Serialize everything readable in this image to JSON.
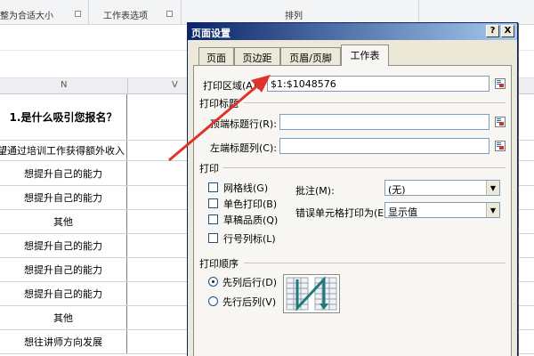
{
  "ribbon": {
    "group_fit": "整为合适大小",
    "group_sheet_options": "工作表选项",
    "group_arrange": "排列"
  },
  "sheet": {
    "col_n": "N",
    "col_v": "V",
    "rows": [
      "1.是什么吸引您报名？",
      "希望通过培训工作获得额外收入",
      "想提升自己的能力",
      "想提升自己的能力",
      "其他",
      "想提升自己的能力",
      "想提升自己的能力",
      "想提升自己的能力",
      "其他",
      "想往讲师方向发展",
      ""
    ]
  },
  "dialog": {
    "title": "页面设置",
    "help_btn": "?",
    "close_btn": "X",
    "tabs": [
      "页面",
      "页边距",
      "页眉/页脚",
      "工作表"
    ],
    "active_tab": 3,
    "print_area_label": "打印区域(A):",
    "print_area_value": "$1:$1048576",
    "print_titles_label": "打印标题",
    "top_rows_label": "顶端标题行(R):",
    "left_cols_label": "左端标题列(C):",
    "print_label": "打印",
    "gridlines_label": "网格线(G)",
    "bw_label": "单色打印(B)",
    "draft_label": "草稿品质(Q)",
    "rowcol_label": "行号列标(L)",
    "comments_label": "批注(M):",
    "comments_value": "(无)",
    "errors_label": "错误单元格打印为(E):",
    "errors_value": "显示值",
    "order_label": "打印顺序",
    "down_over_label": "先列后行(D)",
    "over_down_label": "先行后列(V)"
  },
  "colors": {
    "title_bar": "#0a246a",
    "dialog_bg": "#ece9d8",
    "arrow": "#e0322c"
  }
}
